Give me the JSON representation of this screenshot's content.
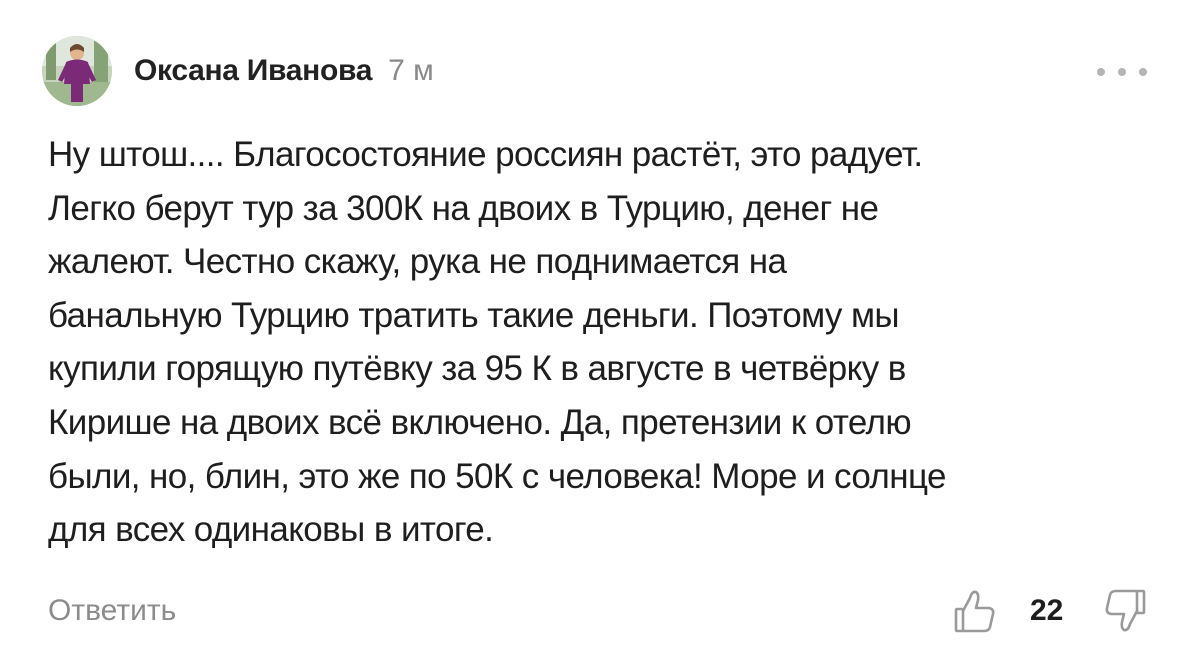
{
  "comment": {
    "author": "Оксана Иванова",
    "time": "7 м",
    "text_lines": [
      "Ну штош.... Благосостояние россиян растёт, это радует.",
      "Легко берут тур за 300К на двоих в Турцию, денег не",
      "жалеют. Честно скажу, рука не поднимается на",
      "банальную Турцию тратить такие деньги. Поэтому мы",
      "купили горящую путёвку за 95 К в августе в четвёрку в",
      "Кирише на двоих всё включено. Да, претензии к отелю",
      "были, но, блин, это же по 50К с человека! Море и солнце",
      "для всех одинаковы в итоге."
    ],
    "reply_label": "Ответить",
    "likes": "22",
    "icons": {
      "avatar": "avatar-photo",
      "more": "more-dots-icon",
      "like": "thumbs-up-icon",
      "dislike": "thumbs-down-icon"
    },
    "colors": {
      "text": "#1e1e1e",
      "muted": "#8c8c8c",
      "icon": "#9a9a9a"
    }
  }
}
